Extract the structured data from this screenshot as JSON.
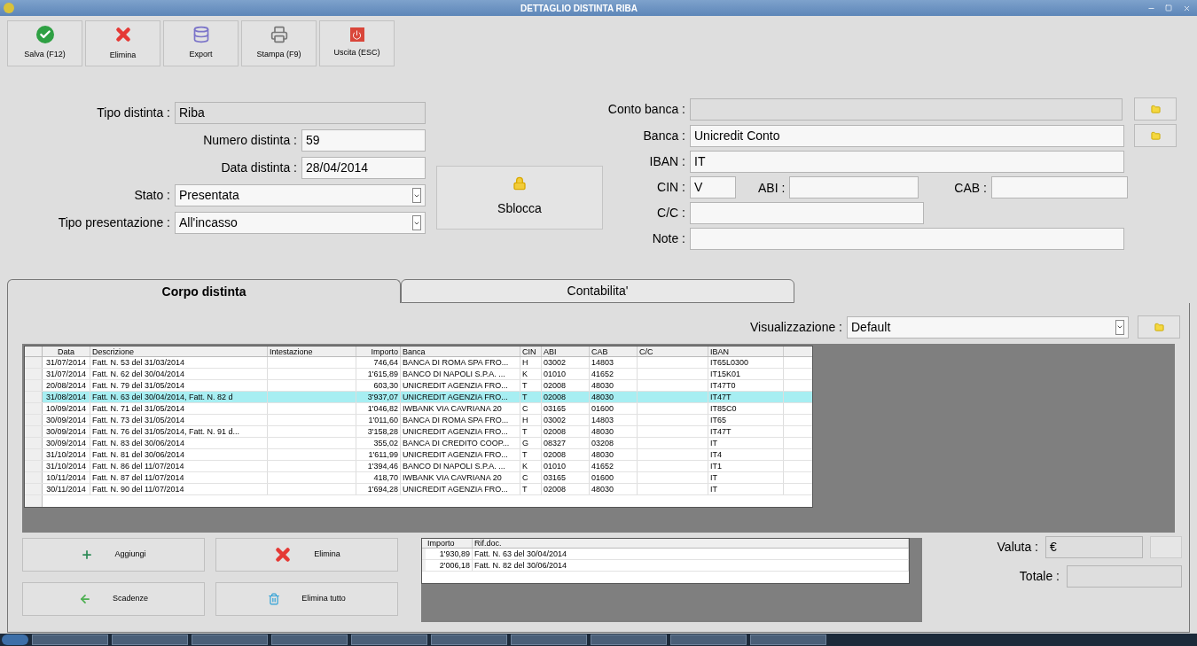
{
  "window": {
    "title": "DETTAGLIO DISTINTA RIBA"
  },
  "toolbar": [
    {
      "label": "Salva (F12)",
      "kind": "save"
    },
    {
      "label": "Elimina",
      "kind": "delete"
    },
    {
      "label": "Export",
      "kind": "export"
    },
    {
      "label": "Stampa (F9)",
      "kind": "print"
    },
    {
      "label": "Uscita (ESC)",
      "kind": "exit"
    }
  ],
  "left_fields": [
    {
      "label": "Tipo distinta :",
      "value": "Riba",
      "kind": "readonly"
    },
    {
      "label": "Numero distinta :",
      "value": "59",
      "kind": "text"
    },
    {
      "label": "Data distinta :",
      "value": "28/04/2014",
      "kind": "text"
    },
    {
      "label": "Stato :",
      "value": "Presentata",
      "kind": "dropdown"
    },
    {
      "label": "Tipo presentazione :",
      "value": "All'incasso",
      "kind": "dropdown"
    }
  ],
  "unlock_button": {
    "label": "Sblocca"
  },
  "right_fields": {
    "conto_banca": {
      "label": "Conto banca :"
    },
    "banca": {
      "label": "Banca :",
      "value": "Unicredit Conto"
    },
    "iban": {
      "label": "IBAN :",
      "value": "IT"
    },
    "cin": {
      "label": "CIN :",
      "value": "V"
    },
    "abi": {
      "label": "ABI :"
    },
    "cab": {
      "label": "CAB :"
    },
    "cc": {
      "label": "C/C :"
    },
    "note": {
      "label": "Note :"
    }
  },
  "tabs": [
    {
      "label": "Corpo distinta",
      "selected": true
    },
    {
      "label": "Contabilita'",
      "selected": false
    }
  ],
  "visualizzazione": {
    "label": "Visualizzazione :",
    "value": "Default"
  },
  "table": {
    "columns": [
      "Data",
      "Descrizione",
      "Intestazione",
      "Importo",
      "Banca",
      "CIN",
      "ABI",
      "CAB",
      "C/C",
      "IBAN"
    ],
    "rows": [
      {
        "cells": [
          "31/07/2014",
          "Fatt. N. 53 del 31/03/2014",
          "",
          "746,64",
          "BANCA DI ROMA SPA FRO...",
          "H",
          "03002",
          "14803",
          "",
          "IT65L0300"
        ],
        "selected": false
      },
      {
        "cells": [
          "31/07/2014",
          "Fatt. N. 62 del 30/04/2014",
          "",
          "1'615,89",
          "BANCO DI NAPOLI S.P.A. ...",
          "K",
          "01010",
          "41652",
          "",
          "IT15K01"
        ],
        "selected": false
      },
      {
        "cells": [
          "20/08/2014",
          "Fatt. N. 79 del 31/05/2014",
          "",
          "603,30",
          "UNICREDIT AGENZIA FRO...",
          "T",
          "02008",
          "48030",
          "",
          "IT47T0"
        ],
        "selected": false
      },
      {
        "cells": [
          "31/08/2014",
          "Fatt. N. 63 del 30/04/2014, Fatt. N. 82 d",
          "",
          "3'937,07",
          "UNICREDIT AGENZIA FRO...",
          "T",
          "02008",
          "48030",
          "",
          "IT47T"
        ],
        "selected": true
      },
      {
        "cells": [
          "10/09/2014",
          "Fatt. N. 71 del 31/05/2014",
          "",
          "1'046,82",
          "IWBANK VIA CAVRIANA 20",
          "C",
          "03165",
          "01600",
          "",
          "IT85C0"
        ],
        "selected": false
      },
      {
        "cells": [
          "30/09/2014",
          "Fatt. N. 73 del 31/05/2014",
          "",
          "1'011,60",
          "BANCA DI ROMA SPA FRO...",
          "H",
          "03002",
          "14803",
          "",
          "IT65"
        ],
        "selected": false
      },
      {
        "cells": [
          "30/09/2014",
          "Fatt. N. 76 del 31/05/2014, Fatt. N. 91 d...",
          "",
          "3'158,28",
          "UNICREDIT AGENZIA FRO...",
          "T",
          "02008",
          "48030",
          "",
          "IT47T"
        ],
        "selected": false
      },
      {
        "cells": [
          "30/09/2014",
          "Fatt. N. 83 del 30/06/2014",
          "",
          "355,02",
          "BANCA DI CREDITO COOP...",
          "G",
          "08327",
          "03208",
          "",
          "IT"
        ],
        "selected": false
      },
      {
        "cells": [
          "31/10/2014",
          "Fatt. N. 81 del 30/06/2014",
          "",
          "1'611,99",
          "UNICREDIT AGENZIA FRO...",
          "T",
          "02008",
          "48030",
          "",
          "IT4"
        ],
        "selected": false
      },
      {
        "cells": [
          "31/10/2014",
          "Fatt. N. 86 del 11/07/2014",
          "",
          "1'394,46",
          "BANCO DI NAPOLI S.P.A. ...",
          "K",
          "01010",
          "41652",
          "",
          "IT1"
        ],
        "selected": false
      },
      {
        "cells": [
          "10/11/2014",
          "Fatt. N. 87 del 11/07/2014",
          "",
          "418,70",
          "IWBANK VIA CAVRIANA 20",
          "C",
          "03165",
          "01600",
          "",
          "IT"
        ],
        "selected": false
      },
      {
        "cells": [
          "30/11/2014",
          "Fatt. N. 90 del 11/07/2014",
          "",
          "1'694,28",
          "UNICREDIT AGENZIA FRO...",
          "T",
          "02008",
          "48030",
          "",
          "IT"
        ],
        "selected": false
      }
    ]
  },
  "bottom_buttons": [
    {
      "label": "Aggiungi",
      "kind": "add"
    },
    {
      "label": "Elimina",
      "kind": "delete"
    },
    {
      "label": "Scadenze",
      "kind": "due"
    },
    {
      "label": "Elimina tutto",
      "kind": "clear"
    }
  ],
  "docs_table": {
    "columns": [
      "Importo",
      "Rif.doc."
    ],
    "rows": [
      [
        "1'930,89",
        "Fatt. N. 63 del 30/04/2014"
      ],
      [
        "2'006,18",
        "Fatt. N. 82 del 30/06/2014"
      ]
    ]
  },
  "valuta": {
    "label": "Valuta :",
    "value": "€"
  },
  "totale": {
    "label": "Totale :"
  }
}
